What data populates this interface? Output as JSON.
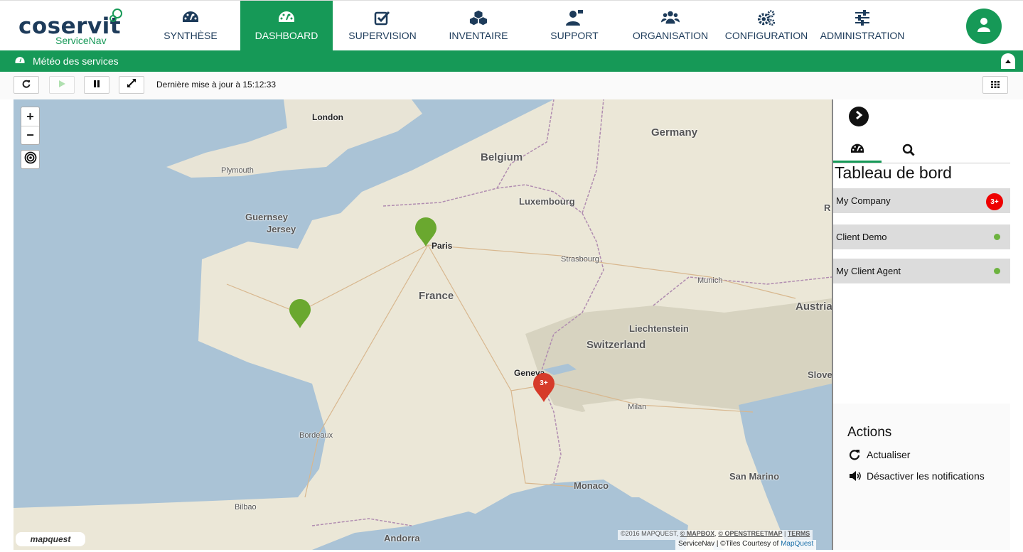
{
  "brand": {
    "name": "coservit",
    "product": "ServiceNav"
  },
  "nav": {
    "items": [
      {
        "label": "SYNTHÈSE",
        "icon": "gauge-icon"
      },
      {
        "label": "DASHBOARD",
        "icon": "dashboard-icon",
        "active": true
      },
      {
        "label": "SUPERVISION",
        "icon": "check-square-icon"
      },
      {
        "label": "INVENTAIRE",
        "icon": "cubes-icon"
      },
      {
        "label": "SUPPORT",
        "icon": "support-user-icon"
      },
      {
        "label": "ORGANISATION",
        "icon": "users-icon"
      },
      {
        "label": "CONFIGURATION",
        "icon": "cogs-icon"
      },
      {
        "label": "ADMINISTRATION",
        "icon": "sliders-icon"
      }
    ],
    "user_icon": "user-icon"
  },
  "subbar": {
    "title": "Météo des services"
  },
  "toolbar": {
    "last_update": "Dernière mise à jour à 15:12:33"
  },
  "map": {
    "labels": {
      "london": "London",
      "germany": "Germany",
      "belgium": "Belgium",
      "plymouth": "Plymouth",
      "guernsey": "Guernsey",
      "jersey": "Jersey",
      "luxembourg": "Luxembourg",
      "paris": "Paris",
      "strasbourg": "Strasbourg",
      "munich": "Munich",
      "france": "France",
      "austria": "Austria",
      "liechtenstein": "Liechtenstein",
      "switzerland": "Switzerland",
      "geneva": "Geneva",
      "slovenia": "Slove",
      "milan": "Milan",
      "bordeaux": "Bordeaux",
      "san_marino": "San Marino",
      "monaco": "Monaco",
      "bilbao": "Bilbao",
      "andorra": "Andorra",
      "r": "R"
    },
    "markers": [
      {
        "status": "ok",
        "color": "#6aa82f",
        "label": ""
      },
      {
        "status": "ok",
        "color": "#6aa82f",
        "label": ""
      },
      {
        "status": "critical",
        "color": "#d63b2a",
        "label": "3+"
      }
    ],
    "zoom_in": "+",
    "zoom_out": "−",
    "provider_logo": "mapquest",
    "attribution_line1_prefix": "©2016 MAPQUEST, ",
    "attribution_mapbox": "© MAPBOX",
    "attribution_osm": "© OPENSTREETMAP",
    "attribution_terms": "TERMS",
    "attribution_line2": "ServiceNav | ©Tiles Courtesy of ",
    "attribution_line2_link": "MapQuest"
  },
  "panel": {
    "title": "Tableau de bord",
    "clients": [
      {
        "name": "My Company",
        "badge": "3+"
      },
      {
        "name": "Client Demo",
        "status": "ok"
      },
      {
        "name": "My Client Agent",
        "status": "ok"
      }
    ],
    "actions": {
      "heading": "Actions",
      "refresh": "Actualiser",
      "mute": "Désactiver les notifications"
    }
  },
  "colors": {
    "primary": "#169957",
    "navy": "#1d3b5a",
    "ok": "#6db33f",
    "critical": "#e00000"
  }
}
